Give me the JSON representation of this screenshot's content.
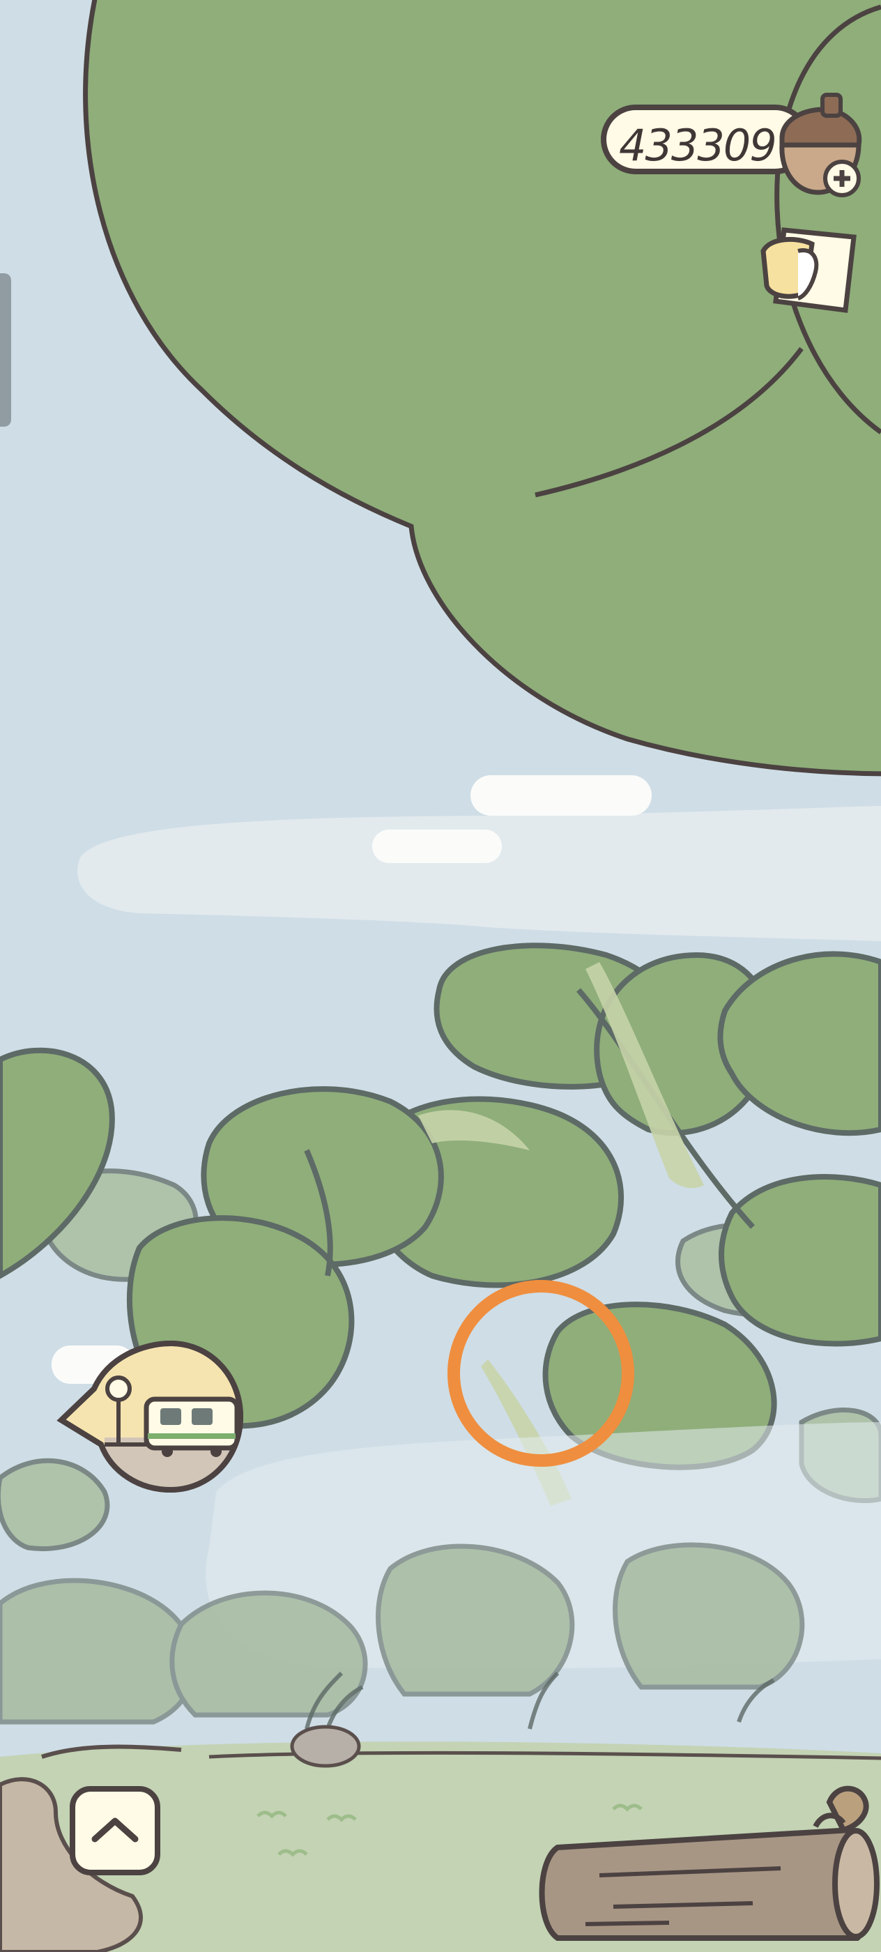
{
  "hud": {
    "acorn_count": "433309",
    "acorn_icon": "acorn-icon",
    "add_icon": "plus-icon",
    "letter_icon": "letter-icon"
  },
  "scene": {
    "travel_icon": "train-bubble-icon",
    "expand_icon": "chevron-up-icon"
  },
  "colors": {
    "sky": "#cfdde6",
    "leaf": "#8fae7a",
    "outline": "#4b4241",
    "cream": "#fffbe6",
    "highlight_ring": "#ef8e3e",
    "grass": "#c3d3b4"
  }
}
